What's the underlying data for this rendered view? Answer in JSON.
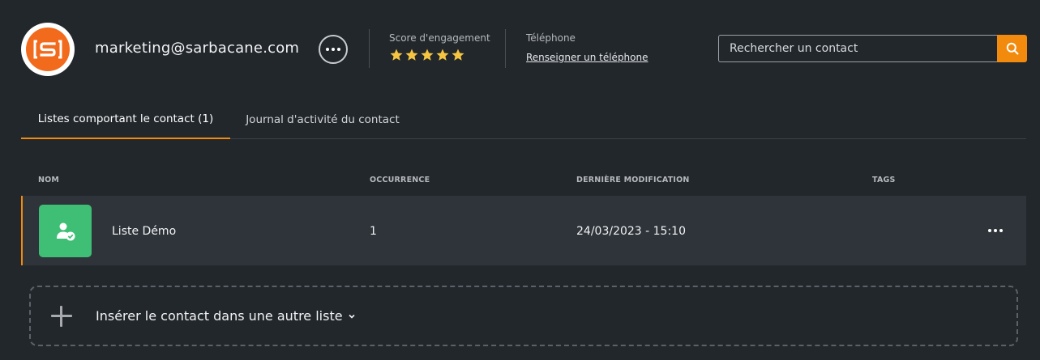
{
  "header": {
    "logo_icon": "sarbacane-logo-icon",
    "email": "marketing@sarbacane.com",
    "more_icon": "more-horizontal-icon",
    "engagement": {
      "label": "Score d'engagement",
      "stars": 5,
      "max_stars": 5
    },
    "phone": {
      "label": "Téléphone",
      "link": "Renseigner un téléphone"
    },
    "search": {
      "placeholder": "Rechercher un contact",
      "value": "",
      "icon": "search-icon"
    }
  },
  "tabs": [
    {
      "label": "Listes comportant le contact (1)",
      "active": true
    },
    {
      "label": "Journal d'activité du contact",
      "active": false
    }
  ],
  "table": {
    "columns": [
      "NOM",
      "OCCURRENCE",
      "DERNIÈRE MODIFICATION",
      "TAGS"
    ],
    "rows": [
      {
        "icon": "user-check-icon",
        "name": "Liste Démo",
        "occurrence": "1",
        "modified": "24/03/2023 - 15:10",
        "tags": ""
      }
    ]
  },
  "insert": {
    "label": "Insérer le contact dans une autre liste",
    "icon": "plus-icon",
    "chevron": "chevron-down-icon"
  },
  "colors": {
    "accent": "#f28a0d",
    "background": "#22272c",
    "row": "#2e343a",
    "list_icon_bg": "#3fbf75",
    "logo": "#f26a1b"
  }
}
